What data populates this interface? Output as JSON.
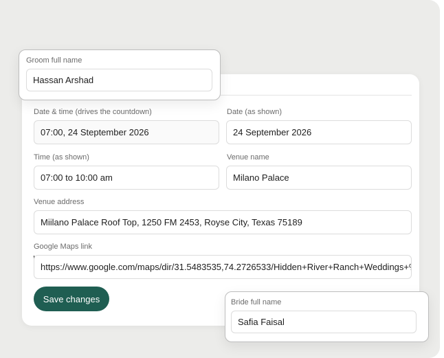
{
  "form": {
    "datetime": {
      "label": "Date & time (drives the countdown)",
      "value": "07:00, 24 Steptember 2026"
    },
    "date_shown": {
      "label": "Date (as shown)",
      "value": "24 September 2026"
    },
    "time_shown": {
      "label": "Time (as shown)",
      "value": "07:00 to 10:00 am"
    },
    "venue_name": {
      "label": "Venue name",
      "value": "Milano Palace"
    },
    "venue_address": {
      "label": "Venue address",
      "value": "Miilano Palace Roof Top, 1250 FM 2453, Royse City, Texas 75189"
    },
    "maps_link": {
      "label": "Google Maps link",
      "value": "https://www.google.com/maps/dir/31.5483535,74.2726533/Hidden+River+Ranch+Weddings+%"
    },
    "save_label": "Save changes"
  },
  "groom_card": {
    "label": "Groom full name",
    "value": "Hassan Arshad"
  },
  "bride_card": {
    "label": "Bride full name",
    "value": "Safia Faisal"
  },
  "colors": {
    "accent": "#1f5e52",
    "background": "#ececea",
    "card": "#ffffff"
  }
}
